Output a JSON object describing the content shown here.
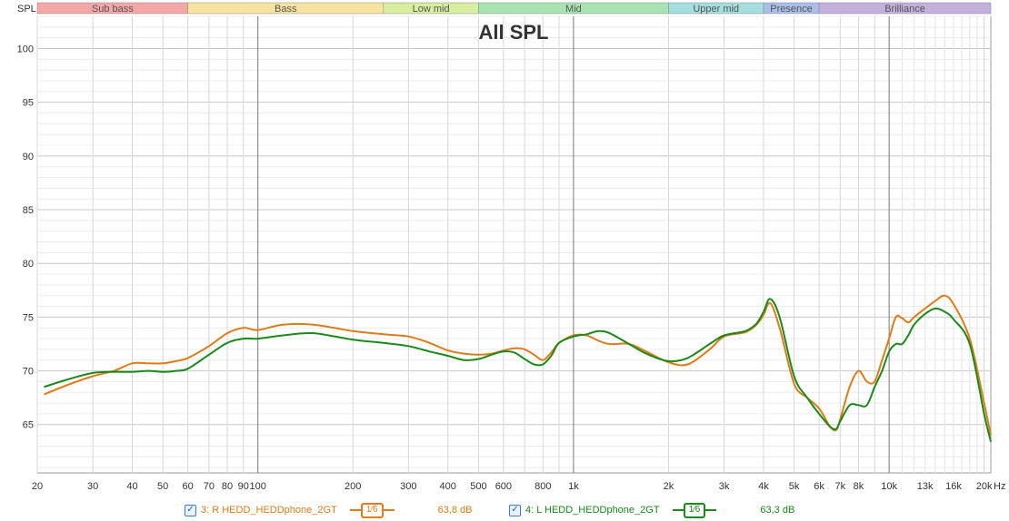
{
  "chart_data": {
    "type": "line",
    "title": "All SPL",
    "ylabel": "SPL",
    "xunit": "Hz",
    "xscale": "log",
    "xlim": [
      20,
      21000
    ],
    "ylim": [
      60.5,
      103
    ],
    "yticks": [
      65,
      70,
      75,
      80,
      85,
      90,
      95,
      100
    ],
    "xticks": [
      {
        "v": 20,
        "label": "20"
      },
      {
        "v": 30,
        "label": "30"
      },
      {
        "v": 40,
        "label": "40"
      },
      {
        "v": 50,
        "label": "50"
      },
      {
        "v": 60,
        "label": "60"
      },
      {
        "v": 70,
        "label": "70"
      },
      {
        "v": 80,
        "label": "80"
      },
      {
        "v": 90,
        "label": "90"
      },
      {
        "v": 100,
        "label": "100"
      },
      {
        "v": 200,
        "label": "200"
      },
      {
        "v": 300,
        "label": "300"
      },
      {
        "v": 400,
        "label": "400"
      },
      {
        "v": 500,
        "label": "500"
      },
      {
        "v": 600,
        "label": "600"
      },
      {
        "v": 800,
        "label": "800"
      },
      {
        "v": 1000,
        "label": "1k"
      },
      {
        "v": 2000,
        "label": "2k"
      },
      {
        "v": 3000,
        "label": "3k"
      },
      {
        "v": 4000,
        "label": "4k"
      },
      {
        "v": 5000,
        "label": "5k"
      },
      {
        "v": 6000,
        "label": "6k"
      },
      {
        "v": 7000,
        "label": "7k"
      },
      {
        "v": 8000,
        "label": "8k"
      },
      {
        "v": 10000,
        "label": "10k"
      },
      {
        "v": 13000,
        "label": "13k"
      },
      {
        "v": 16000,
        "label": "16k"
      },
      {
        "v": 20000,
        "label": "20k"
      }
    ],
    "bands": [
      {
        "name": "Sub bass",
        "from": 20,
        "to": 60,
        "color": "#f4a7a7"
      },
      {
        "name": "Bass",
        "from": 60,
        "to": 250,
        "color": "#f7e3a0"
      },
      {
        "name": "Low mid",
        "from": 250,
        "to": 500,
        "color": "#d7ee9e"
      },
      {
        "name": "Mid",
        "from": 500,
        "to": 2000,
        "color": "#a8e4b3"
      },
      {
        "name": "Upper mid",
        "from": 2000,
        "to": 4000,
        "color": "#a5dede"
      },
      {
        "name": "Presence",
        "from": 4000,
        "to": 6000,
        "color": "#a9bfe8"
      },
      {
        "name": "Brilliance",
        "from": 6000,
        "to": 21000,
        "color": "#c4b0dd"
      }
    ],
    "series": [
      {
        "name": "3: R HEDD_HEDDphone_2GT",
        "color": "#e07b18",
        "smoothing": "1⁄6",
        "level": "63,8 dB",
        "x": [
          21,
          25,
          30,
          35,
          40,
          45,
          50,
          55,
          60,
          70,
          80,
          90,
          100,
          120,
          150,
          200,
          250,
          300,
          350,
          400,
          450,
          500,
          550,
          600,
          650,
          700,
          750,
          800,
          850,
          900,
          1000,
          1100,
          1200,
          1300,
          1500,
          1700,
          2000,
          2300,
          2700,
          3000,
          3500,
          3800,
          4000,
          4200,
          4500,
          5000,
          5500,
          6000,
          6500,
          6800,
          7000,
          7500,
          8000,
          8500,
          9000,
          9500,
          10000,
          10500,
          11000,
          11500,
          12000,
          13000,
          14000,
          15000,
          16000,
          18000,
          20000,
          21000
        ],
        "y": [
          67.8,
          68.7,
          69.5,
          70.0,
          70.7,
          70.7,
          70.7,
          70.9,
          71.2,
          72.3,
          73.5,
          74.0,
          73.8,
          74.3,
          74.3,
          73.7,
          73.4,
          73.2,
          72.6,
          71.9,
          71.6,
          71.5,
          71.6,
          71.9,
          72.1,
          72.0,
          71.5,
          71.0,
          71.7,
          72.6,
          73.3,
          73.3,
          72.8,
          72.5,
          72.5,
          71.8,
          70.8,
          70.6,
          72.0,
          73.2,
          73.6,
          74.3,
          75.2,
          76.3,
          74.0,
          68.8,
          67.5,
          66.5,
          64.8,
          64.5,
          65.5,
          68.5,
          70.0,
          69.0,
          69.0,
          71.0,
          73.0,
          75.0,
          74.9,
          74.5,
          75.0,
          75.8,
          76.5,
          77.0,
          76.2,
          73.0,
          67.0,
          64.0
        ]
      },
      {
        "name": "4: L HEDD_HEDDphone_2GT",
        "color": "#1a8a1a",
        "smoothing": "1⁄6",
        "level": "63,3 dB",
        "x": [
          21,
          25,
          30,
          35,
          40,
          45,
          50,
          55,
          60,
          70,
          80,
          90,
          100,
          120,
          150,
          200,
          250,
          300,
          350,
          400,
          450,
          500,
          550,
          600,
          650,
          700,
          750,
          800,
          850,
          900,
          1000,
          1100,
          1200,
          1300,
          1500,
          1700,
          2000,
          2300,
          2700,
          3000,
          3500,
          3800,
          4000,
          4200,
          4500,
          5000,
          5500,
          6000,
          6500,
          6800,
          7000,
          7500,
          8000,
          8500,
          9000,
          9500,
          10000,
          10500,
          11000,
          11500,
          12000,
          13000,
          14000,
          15000,
          16000,
          18000,
          20000,
          21000
        ],
        "y": [
          68.5,
          69.2,
          69.8,
          69.9,
          69.9,
          70.0,
          69.9,
          70.0,
          70.2,
          71.5,
          72.6,
          73.0,
          73.0,
          73.3,
          73.5,
          72.9,
          72.6,
          72.3,
          71.8,
          71.4,
          71.0,
          71.1,
          71.5,
          71.8,
          71.7,
          71.1,
          70.6,
          70.6,
          71.4,
          72.6,
          73.2,
          73.4,
          73.7,
          73.5,
          72.5,
          71.6,
          70.9,
          71.2,
          72.5,
          73.3,
          73.7,
          74.4,
          75.5,
          76.7,
          75.0,
          69.5,
          67.5,
          66.0,
          64.8,
          64.6,
          65.3,
          66.8,
          66.8,
          66.8,
          68.5,
          70.0,
          71.8,
          72.5,
          72.5,
          73.3,
          74.3,
          75.3,
          75.8,
          75.5,
          74.8,
          72.5,
          66.0,
          63.4
        ]
      }
    ]
  },
  "legend": [
    {
      "label": "3: R HEDD_HEDDphone_2GT",
      "smoothing": "1⁄6",
      "level": "63,8 dB",
      "color": "#e07b18"
    },
    {
      "label": "4: L HEDD_HEDDphone_2GT",
      "smoothing": "1⁄6",
      "level": "63,3 dB",
      "color": "#1a8a1a"
    }
  ]
}
